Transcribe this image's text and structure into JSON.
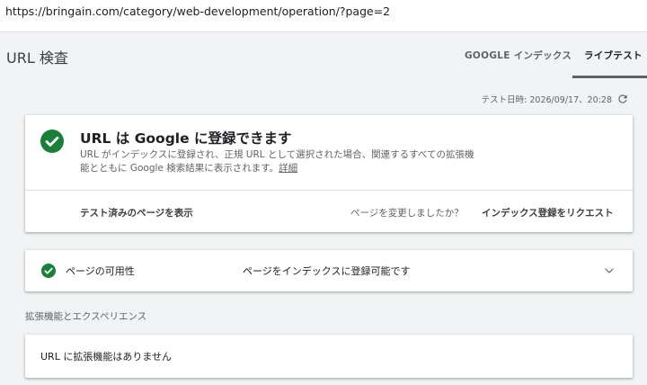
{
  "browser": {
    "url": "https://bringain.com/category/web-development/operation/?page=2"
  },
  "header": {
    "title": "URL 検査",
    "tabs": [
      {
        "label": "GOOGLE インデックス",
        "active": false
      },
      {
        "label": "ライブテスト",
        "active": true
      }
    ]
  },
  "test_date": "テスト日時: 2026/09/17、20:28",
  "icons": {
    "refresh": "refresh-icon",
    "check": "check-circle-icon",
    "expand": "chevron-down-icon"
  },
  "colors": {
    "success_green": "#188038",
    "text_primary": "#202124",
    "text_secondary": "#5f6368"
  },
  "main_card": {
    "heading": "URL は Google に登録できます",
    "description": "URL がインデックスに登録され、正規 URL として選択された場合、関連するすべての拡張機能とともに Google 検索結果に表示されます。",
    "details_link": "詳細",
    "view_tested_page": "テスト済みのページを表示",
    "changed_question": "ページを変更しましたか？",
    "request_indexing": "インデックス登録をリクエスト"
  },
  "availability": {
    "label": "ページの可用性",
    "value": "ページをインデックスに登録可能です"
  },
  "enhancements": {
    "section_title": "拡張機能とエクスペリエンス",
    "none_text": "URL に拡張機能はありません"
  }
}
